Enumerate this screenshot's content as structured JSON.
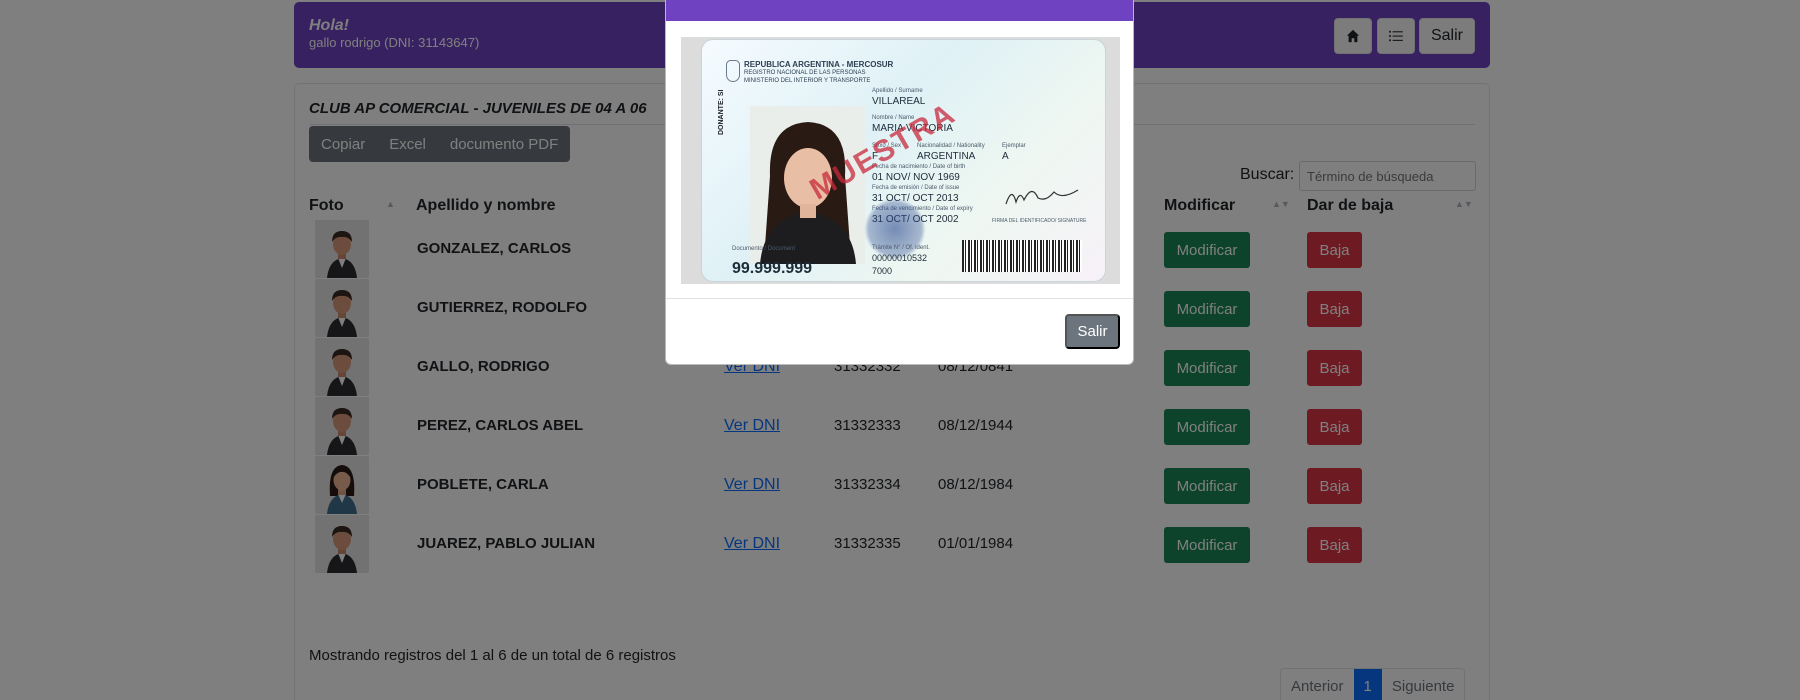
{
  "header": {
    "greeting": "Hola!",
    "user_line": "gallo rodrigo (DNI: 31143647)",
    "home_icon": "house-icon",
    "list_icon": "list-icon",
    "logout_label": "Salir"
  },
  "card": {
    "title": "CLUB AP COMERCIAL - JUVENILES DE 04 A 06",
    "export_buttons": [
      "Copiar",
      "Excel",
      "documento PDF"
    ],
    "search_label": "Buscar:",
    "search_placeholder": "Término de búsqueda"
  },
  "table": {
    "columns": [
      "Foto",
      "Apellido y nombre",
      "Modificar",
      "Dar de baja"
    ],
    "rows": [
      {
        "name": "GONZALEZ, CARLOS",
        "link": "",
        "dni": "",
        "date": "",
        "avatar": "male"
      },
      {
        "name": "GUTIERREZ, RODOLFO",
        "link": "",
        "dni": "",
        "date": "",
        "avatar": "male"
      },
      {
        "name": "GALLO, RODRIGO",
        "link": "Ver DNI",
        "dni": "31332332",
        "date": "08/12/0841",
        "avatar": "male"
      },
      {
        "name": "PEREZ, CARLOS ABEL",
        "link": "Ver DNI",
        "dni": "31332333",
        "date": "08/12/1944",
        "avatar": "male"
      },
      {
        "name": "POBLETE, CARLA",
        "link": "Ver DNI",
        "dni": "31332334",
        "date": "08/12/1984",
        "avatar": "female"
      },
      {
        "name": "JUAREZ, PABLO JULIAN",
        "link": "Ver DNI",
        "dni": "31332335",
        "date": "01/01/1984",
        "avatar": "male"
      }
    ],
    "modify_label": "Modificar",
    "delete_label": "Baja"
  },
  "footer": {
    "info": "Mostrando registros del 1 al 6 de un total de 6 registros",
    "prev": "Anterior",
    "page": "1",
    "next": "Siguiente"
  },
  "modal": {
    "title": "",
    "close_label": "Salir",
    "dni_card": {
      "header1": "REPUBLICA ARGENTINA - MERCOSUR",
      "header2": "REGISTRO NACIONAL DE LAS PERSONAS",
      "header3": "MINISTERIO DEL INTERIOR Y TRANSPORTE",
      "surname_label": "Apellido / Surname",
      "surname": "VILLAREAL",
      "name_label": "Nombre / Name",
      "name": "MARIA VICTORIA",
      "sex_label": "Sexo / Sex",
      "sex": "F",
      "nationality_label": "Nacionalidad / Nationality",
      "nationality": "ARGENTINA",
      "copy_label": "Ejemplar",
      "copy": "A",
      "birth_label": "Fecha de nacimiento / Date of birth",
      "birth": "01 NOV/ NOV 1969",
      "issue_label": "Fecha de emisión / Date of issue",
      "issue": "31 OCT/ OCT 2013",
      "expiry_label": "Fecha de vencimiento / Date of expiry",
      "expiry": "31 OCT/ OCT 2002",
      "doc_label": "Documento / Document",
      "doc_number": "99.999.999",
      "tramite_label": "Trámite N° / Of. ident.",
      "tramite": "00000010532",
      "office": "7000",
      "signature_label": "FIRMA DEL IDENTIFICADO/ SIGNATURE",
      "watermark": "MUESTRA",
      "donor": "DONANTE: SI"
    }
  },
  "colors": {
    "brand": "#6f42c1",
    "success": "#198754",
    "danger": "#dc3545",
    "secondary": "#6c757d",
    "primary": "#0d6efd"
  }
}
